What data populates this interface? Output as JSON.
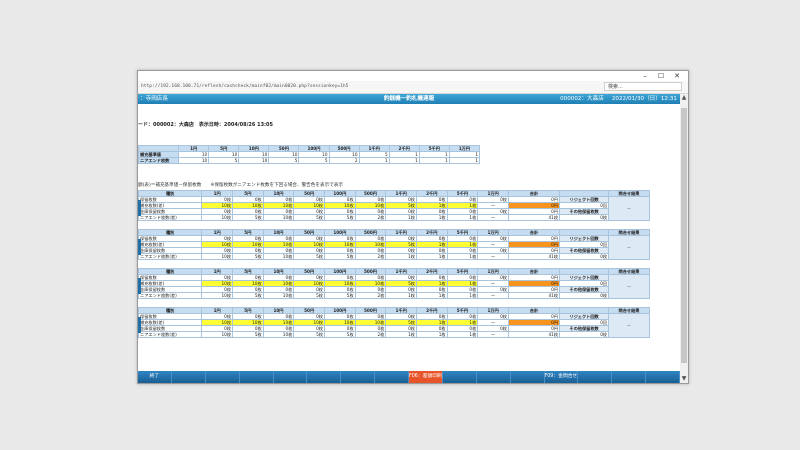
{
  "browser": {
    "url": "http://192.168.100.71/reflesh/cashcheck/mainf02/main0020.php?sessionkey=1h5",
    "search_placeholder": "検索...",
    "controls": [
      "–",
      "☐",
      "✕"
    ]
  },
  "header": {
    "left": "：寺岡店長",
    "title": "釣銭機一釣札機連報",
    "store": "000002：大森店",
    "date": "2022/01/30（日）12:31"
  },
  "subheader": "ード：000002：大森店　表示日時：2004/08/26 13:05",
  "top_table": {
    "headers": [
      "",
      "1円",
      "5円",
      "10円",
      "50円",
      "100円",
      "500円",
      "1千円",
      "2千円",
      "5千円",
      "1万円"
    ],
    "rows": [
      {
        "label": "補充基準値",
        "values": [
          "10",
          "10",
          "10",
          "10",
          "10",
          "10",
          "5",
          "1",
          "1",
          "1"
        ]
      },
      {
        "label": "ニアエンド枚数",
        "values": [
          "10",
          "5",
          "10",
          "5",
          "5",
          "2",
          "1",
          "1",
          "1",
          "1"
        ]
      }
    ]
  },
  "note": "額(表)＝補充基準値－保留枚数　　※保留枚数がニアエンド枚数を下回る場合、警告色を表示で表示",
  "blocks": [
    {
      "headers": [
        "種別",
        "1円",
        "5円",
        "10円",
        "50円",
        "100円",
        "500円",
        "1千円",
        "2千円",
        "5千円",
        "1万円",
        "合計",
        "リジェクト回数",
        "問合せ結果"
      ],
      "rows": [
        {
          "label": "保留枚数",
          "values": [
            "0枚",
            "0枚",
            "0枚",
            "0枚",
            "0枚",
            "0枚",
            "0枚",
            "0枚",
            "0枚",
            "0枚",
            "0円"
          ]
        },
        {
          "label": "補充枚数(差)",
          "values": [
            "10枚",
            "10枚",
            "10枚",
            "10枚",
            "10枚",
            "10枚",
            "5枚",
            "1枚",
            "1枚",
            "一",
            "0円"
          ]
        },
        {
          "label": "金庫保留枚数",
          "values": [
            "0枚",
            "0枚",
            "0枚",
            "0枚",
            "0枚",
            "0枚",
            "0枚",
            "0枚",
            "0枚",
            "0枚",
            "0円"
          ]
        },
        {
          "label": "ニアエンド枚数(差)",
          "values": [
            "10枚",
            "5枚",
            "10枚",
            "5枚",
            "5枚",
            "2枚",
            "1枚",
            "1枚",
            "1枚",
            "一",
            "41枚"
          ]
        }
      ],
      "reject_count": "0回",
      "other_label": "その他保留枚数",
      "other_value": "0枚",
      "inquiry_result": "－"
    },
    {
      "headers": [
        "種別",
        "1円",
        "5円",
        "10円",
        "50円",
        "100円",
        "500円",
        "1千円",
        "2千円",
        "5千円",
        "1万円",
        "合計",
        "リジェクト回数",
        "問合せ結果"
      ],
      "rows": [
        {
          "label": "保留枚数",
          "values": [
            "0枚",
            "0枚",
            "0枚",
            "0枚",
            "0枚",
            "0枚",
            "0枚",
            "0枚",
            "0枚",
            "0枚",
            "0円"
          ]
        },
        {
          "label": "補充枚数(差)",
          "values": [
            "10枚",
            "10枚",
            "10枚",
            "10枚",
            "10枚",
            "10枚",
            "5枚",
            "1枚",
            "1枚",
            "一",
            "0円"
          ]
        },
        {
          "label": "金庫保留枚数",
          "values": [
            "0枚",
            "0枚",
            "0枚",
            "0枚",
            "0枚",
            "0枚",
            "0枚",
            "0枚",
            "0枚",
            "0枚",
            "0円"
          ]
        },
        {
          "label": "ニアエンド枚数(差)",
          "values": [
            "10枚",
            "5枚",
            "10枚",
            "5枚",
            "5枚",
            "2枚",
            "1枚",
            "1枚",
            "1枚",
            "一",
            "41枚"
          ]
        }
      ],
      "reject_count": "0回",
      "other_label": "その他保留枚数",
      "other_value": "0枚",
      "inquiry_result": "－"
    },
    {
      "headers": [
        "種別",
        "1円",
        "5円",
        "10円",
        "50円",
        "100円",
        "500円",
        "1千円",
        "2千円",
        "5千円",
        "1万円",
        "合計",
        "リジェクト回数",
        "問合せ結果"
      ],
      "rows": [
        {
          "label": "保留枚数",
          "values": [
            "0枚",
            "0枚",
            "0枚",
            "0枚",
            "0枚",
            "0枚",
            "0枚",
            "0枚",
            "0枚",
            "0枚",
            "0円"
          ]
        },
        {
          "label": "補充枚数(差)",
          "values": [
            "10枚",
            "10枚",
            "10枚",
            "10枚",
            "10枚",
            "10枚",
            "5枚",
            "1枚",
            "1枚",
            "一",
            "0円"
          ]
        },
        {
          "label": "金庫保留枚数",
          "values": [
            "0枚",
            "0枚",
            "0枚",
            "0枚",
            "0枚",
            "0枚",
            "0枚",
            "0枚",
            "0枚",
            "0枚",
            "0円"
          ]
        },
        {
          "label": "ニアエンド枚数(差)",
          "values": [
            "10枚",
            "5枚",
            "10枚",
            "5枚",
            "5枚",
            "2枚",
            "1枚",
            "1枚",
            "1枚",
            "一",
            "41枚"
          ]
        }
      ],
      "reject_count": "0回",
      "other_label": "その他保留枚数",
      "other_value": "0枚",
      "inquiry_result": "－"
    },
    {
      "headers": [
        "種別",
        "1円",
        "5円",
        "10円",
        "50円",
        "100円",
        "500円",
        "1千円",
        "2千円",
        "5千円",
        "1万円",
        "合計",
        "リジェクト回数",
        "問合せ結果"
      ],
      "rows": [
        {
          "label": "保留枚数",
          "values": [
            "0枚",
            "0枚",
            "0枚",
            "0枚",
            "0枚",
            "0枚",
            "0枚",
            "0枚",
            "0枚",
            "0枚",
            "0円"
          ]
        },
        {
          "label": "補充枚数(差)",
          "values": [
            "10枚",
            "10枚",
            "10枚",
            "10枚",
            "10枚",
            "10枚",
            "5枚",
            "1枚",
            "1枚",
            "一",
            "0円"
          ]
        },
        {
          "label": "金庫保留枚数",
          "values": [
            "0枚",
            "0枚",
            "0枚",
            "0枚",
            "0枚",
            "0枚",
            "0枚",
            "0枚",
            "0枚",
            "0枚",
            "0円"
          ]
        },
        {
          "label": "ニアエンド枚数(差)",
          "values": [
            "10枚",
            "5枚",
            "10枚",
            "5枚",
            "5枚",
            "2枚",
            "1枚",
            "1枚",
            "1枚",
            "一",
            "41枚"
          ]
        }
      ],
      "reject_count": "0回",
      "other_label": "その他保留枚数",
      "other_value": "0枚",
      "inquiry_result": "－"
    }
  ],
  "footer": [
    "終了",
    "",
    "",
    "",
    "",
    "",
    "",
    "",
    "F06：差額印刷",
    "",
    "",
    "",
    "F09：金問合せ",
    "",
    "",
    ""
  ],
  "colors": {
    "header": "#1f7fb4",
    "highlight": "#ffff33",
    "total_highlight": "#f7941d",
    "footer": "#1f6ca6",
    "print_button": "#e8542a"
  }
}
